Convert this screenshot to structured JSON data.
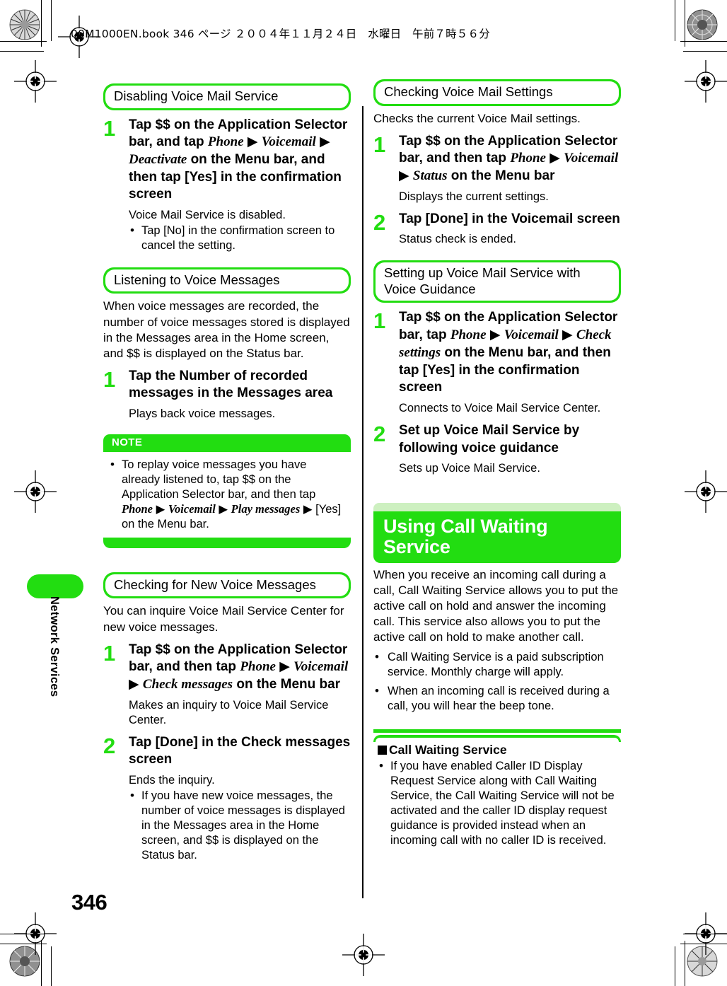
{
  "header": {
    "book_line": "00M1000EN.book   346 ページ  ２００４年１１月２４日　水曜日　午前７時５６分"
  },
  "sidebar": {
    "chapter_label": "Network Services",
    "page_number": "346"
  },
  "left_column": {
    "sections": [
      {
        "heading": "Disabling Voice Mail Service",
        "steps": [
          {
            "num": "1",
            "title_parts": [
              {
                "text": "Tap $$ on the Application Selector bar, and tap ",
                "style": "bold"
              },
              {
                "text": "Phone",
                "style": "italic"
              },
              {
                "text": " ▶ ",
                "style": "arrow"
              },
              {
                "text": "Voicemail",
                "style": "italic"
              },
              {
                "text": " ▶ ",
                "style": "arrow"
              },
              {
                "text": "Deactivate",
                "style": "italic"
              },
              {
                "text": " on the Menu bar, and then tap [Yes] in the confirmation screen",
                "style": "bold"
              }
            ],
            "body": "Voice Mail Service is disabled.",
            "bullets": [
              "Tap [No] in the confirmation screen to cancel the setting."
            ]
          }
        ]
      },
      {
        "heading": "Listening to Voice Messages",
        "intro": "When voice messages are recorded, the number of voice messages stored is displayed in the Messages area in the Home screen, and $$ is displayed on the Status bar.",
        "steps": [
          {
            "num": "1",
            "title_parts": [
              {
                "text": "Tap the Number of recorded messages in the Messages area",
                "style": "bold"
              }
            ],
            "body": "Plays back voice messages.",
            "bullets": []
          }
        ]
      }
    ],
    "note": {
      "label": "NOTE",
      "bullet_parts": [
        {
          "text": "To replay voice messages you have already listened to, tap $$ on the Application Selector bar, and then tap ",
          "style": "plain"
        },
        {
          "text": "Phone",
          "style": "italic"
        },
        {
          "text": " ▶ ",
          "style": "arrow"
        },
        {
          "text": "Voicemail",
          "style": "italic"
        },
        {
          "text": " ▶ ",
          "style": "arrow"
        },
        {
          "text": "Play messages",
          "style": "italic"
        },
        {
          "text": " ▶ ",
          "style": "arrow"
        },
        {
          "text": "[Yes] on the Menu bar.",
          "style": "plain"
        }
      ]
    },
    "section_last": {
      "heading": "Checking for New Voice Messages",
      "intro": "You can inquire Voice Mail Service Center for new voice messages.",
      "steps": [
        {
          "num": "1",
          "title_parts": [
            {
              "text": "Tap $$ on the Application Selector bar, and then tap ",
              "style": "bold"
            },
            {
              "text": "Phone",
              "style": "italic"
            },
            {
              "text": " ▶ ",
              "style": "arrow"
            },
            {
              "text": "Voicemail",
              "style": "italic"
            },
            {
              "text": " ▶ ",
              "style": "arrow"
            },
            {
              "text": "Check messages",
              "style": "italic"
            },
            {
              "text": " on the Menu bar",
              "style": "bold"
            }
          ],
          "body": "Makes an inquiry to Voice Mail Service Center.",
          "bullets": []
        },
        {
          "num": "2",
          "title_parts": [
            {
              "text": "Tap [Done] in the Check messages screen",
              "style": "bold"
            }
          ],
          "body": "Ends the inquiry.",
          "bullets": [
            "If you have new voice messages, the number of voice messages is displayed in the Messages area in the Home screen, and $$ is displayed on the Status bar."
          ]
        }
      ]
    }
  },
  "right_column": {
    "sections": [
      {
        "heading": "Checking Voice Mail Settings",
        "intro": "Checks the current Voice Mail settings.",
        "steps": [
          {
            "num": "1",
            "title_parts": [
              {
                "text": "Tap $$ on the Application Selector bar, and then tap ",
                "style": "bold"
              },
              {
                "text": "Phone",
                "style": "italic"
              },
              {
                "text": " ▶ ",
                "style": "arrow"
              },
              {
                "text": "Voicemail",
                "style": "italic"
              },
              {
                "text": " ▶ ",
                "style": "arrow"
              },
              {
                "text": "Status",
                "style": "italic"
              },
              {
                "text": " on the Menu bar",
                "style": "bold"
              }
            ],
            "body": "Displays the current settings.",
            "bullets": []
          },
          {
            "num": "2",
            "title_parts": [
              {
                "text": "Tap [Done] in the Voicemail screen",
                "style": "bold"
              }
            ],
            "body": "Status check is ended.",
            "bullets": []
          }
        ]
      },
      {
        "heading": "Setting up Voice Mail Service with Voice Guidance",
        "steps": [
          {
            "num": "1",
            "title_parts": [
              {
                "text": "Tap $$ on the Application Selector bar, tap ",
                "style": "bold"
              },
              {
                "text": "Phone",
                "style": "italic"
              },
              {
                "text": " ▶ ",
                "style": "arrow"
              },
              {
                "text": "Voicemail",
                "style": "italic"
              },
              {
                "text": " ▶ ",
                "style": "arrow"
              },
              {
                "text": "Check settings",
                "style": "italic"
              },
              {
                "text": " on the Menu bar, and then tap [Yes] in the confirmation screen",
                "style": "bold"
              }
            ],
            "body": "Connects to Voice Mail Service Center.",
            "bullets": []
          },
          {
            "num": "2",
            "title_parts": [
              {
                "text": "Set up Voice Mail Service by following voice guidance",
                "style": "bold"
              }
            ],
            "body": "Sets up Voice Mail Service.",
            "bullets": []
          }
        ]
      }
    ],
    "banner": {
      "title": "Using Call Waiting Service",
      "intro": "When you receive an incoming call during a call, Call Waiting Service allows you to put the active call on hold and answer the incoming call. This service also allows you to put the active call on hold to make another call.",
      "bullets": [
        "Call Waiting Service is a paid subscription service. Monthly charge will apply.",
        "When an incoming call is received during a call, you will hear the beep tone."
      ]
    },
    "infobox": {
      "title": "Call Waiting Service",
      "bullets": [
        "If you have enabled Caller ID Display Request Service along with Call Waiting Service, the Call Waiting Service will not be activated and the caller ID display request guidance is provided instead when an incoming call with no caller ID is received."
      ]
    }
  },
  "colors": {
    "green": "#22dd11",
    "pale_green": "#cdf0c0",
    "white": "#ffffff",
    "black": "#000000"
  }
}
